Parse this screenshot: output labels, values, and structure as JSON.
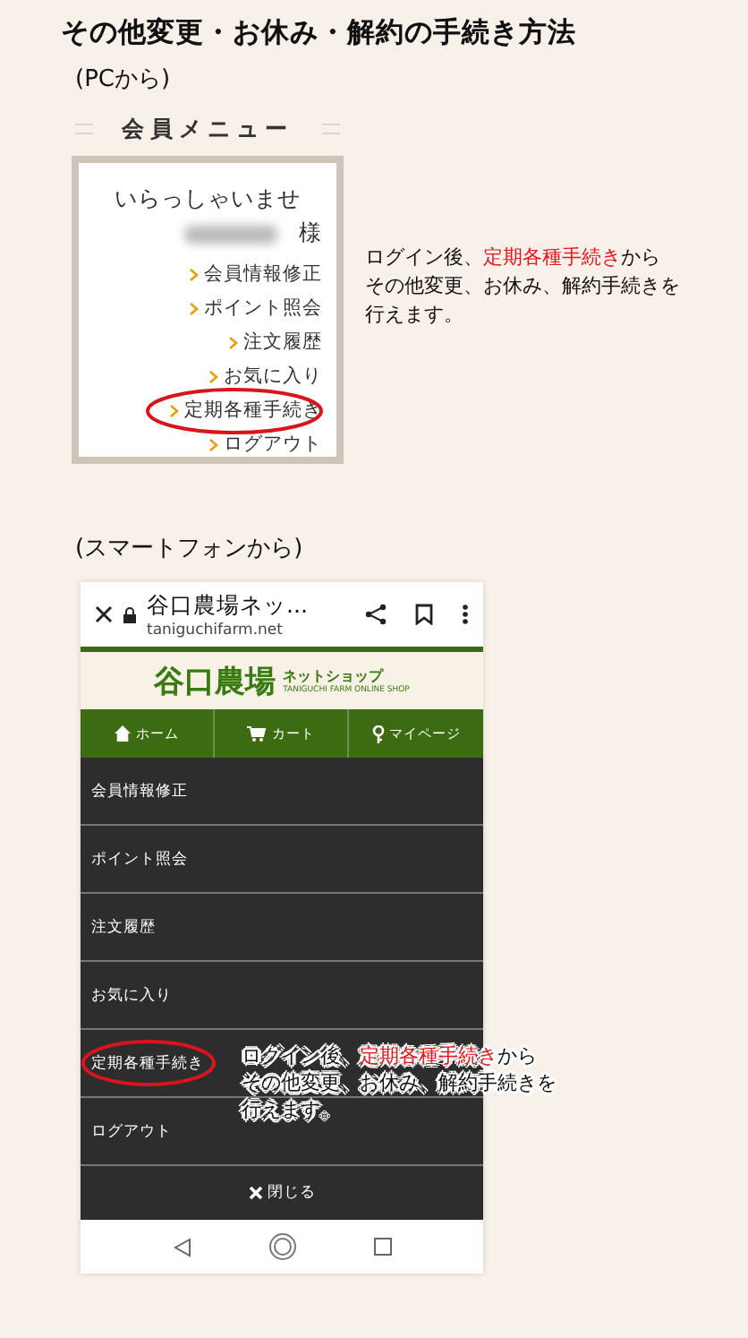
{
  "title": "その他変更・お休み・解約の手続き方法",
  "pc": {
    "heading": "(PCから)",
    "menu_title": "会員メニュー",
    "welcome": "いらっしゃいませ",
    "honorific": "様",
    "items": [
      {
        "label": "会員情報修正",
        "circled": false
      },
      {
        "label": "ポイント照会",
        "circled": false
      },
      {
        "label": "注文履歴",
        "circled": false
      },
      {
        "label": "お気に入り",
        "circled": false
      },
      {
        "label": "定期各種手続き",
        "circled": true
      },
      {
        "label": "ログアウト",
        "circled": false
      }
    ],
    "note": [
      [
        {
          "text": "ログイン後、",
          "highlight": false
        },
        {
          "text": "定期各種手続き",
          "highlight": true
        },
        {
          "text": "から",
          "highlight": false
        }
      ],
      [
        {
          "text": "その他変更、お休み、解約手続きを",
          "highlight": false
        }
      ],
      [
        {
          "text": "行えます。",
          "highlight": false
        }
      ]
    ]
  },
  "sp": {
    "heading": "(スマートフォンから)",
    "browser": {
      "title": "谷口農場ネッ...",
      "url": "taniguchifarm.net"
    },
    "logo": {
      "main": "谷口農場",
      "sub": "ネットショップ",
      "en": "TANIGUCHI FARM ONLINE SHOP"
    },
    "nav": [
      {
        "kind": "home",
        "label": "ホーム"
      },
      {
        "kind": "cart",
        "label": "カート"
      },
      {
        "kind": "mypage",
        "label": "マイページ"
      }
    ],
    "items": [
      {
        "label": "会員情報修正",
        "circled": false
      },
      {
        "label": "ポイント照会",
        "circled": false
      },
      {
        "label": "注文履歴",
        "circled": false
      },
      {
        "label": "お気に入り",
        "circled": false
      },
      {
        "label": "定期各種手続き",
        "circled": true
      },
      {
        "label": "ログアウト",
        "circled": false
      }
    ],
    "close": "閉じる",
    "note": [
      [
        {
          "text": "ログイン後、",
          "highlight": false
        },
        {
          "text": "定期各種手続き",
          "highlight": true
        },
        {
          "text": "から",
          "highlight": false
        }
      ],
      [
        {
          "text": "その他変更、お休み、解約手続きを",
          "highlight": false
        }
      ],
      [
        {
          "text": "行えます。",
          "highlight": false
        }
      ]
    ]
  }
}
